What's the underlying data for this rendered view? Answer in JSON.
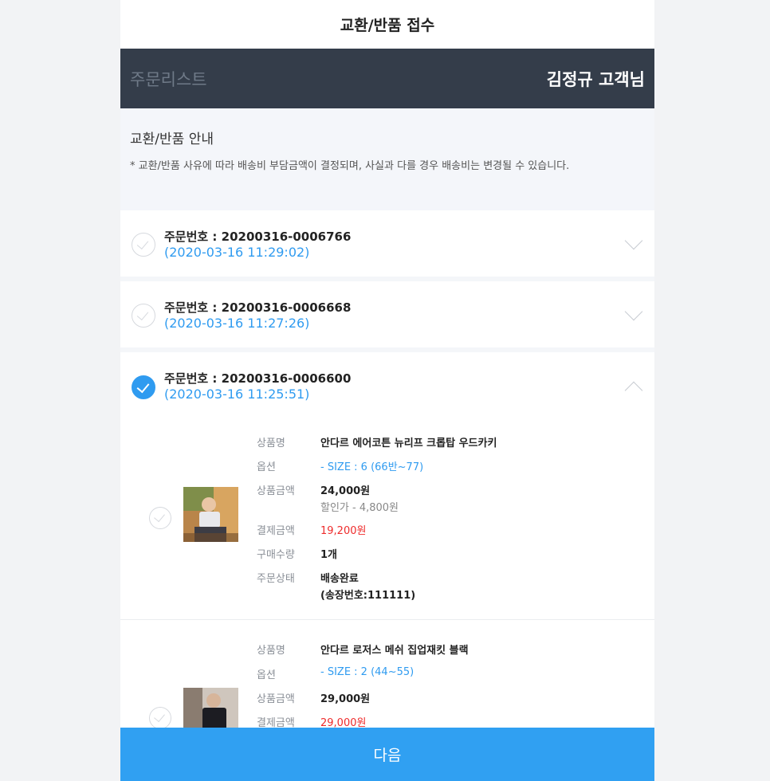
{
  "topbar": {
    "title": "교환/반품 접수"
  },
  "header": {
    "left": "주문리스트",
    "right": "김정규 고객님"
  },
  "notice": {
    "title": "교환/반품 안내",
    "text": "* 교환/반품 사유에 따라 배송비 부담금액이 결정되며, 사실과 다를 경우 배송비는 변경될 수 있습니다."
  },
  "orders": [
    {
      "number": "주문번호 : 20200316-0006766",
      "date": "(2020-03-16 11:29:02)",
      "selected": false,
      "expanded": false
    },
    {
      "number": "주문번호 : 20200316-0006668",
      "date": "(2020-03-16 11:27:26)",
      "selected": false,
      "expanded": false
    },
    {
      "number": "주문번호 : 20200316-0006600",
      "date": "(2020-03-16 11:25:51)",
      "selected": true,
      "expanded": true
    }
  ],
  "labels": {
    "product_name": "상품명",
    "option": "옵션",
    "price": "상품금액",
    "payment": "결제금액",
    "quantity": "구매수량",
    "status": "주문상태"
  },
  "products": [
    {
      "name": "안다르 에어코튼 뉴리프 크롭탑 우드카키",
      "option": "- SIZE : 6 (66반~77)",
      "price": "24,000원",
      "discount": "할인가 - 4,800원",
      "payment": "19,200원",
      "quantity": "1개",
      "status": "배송완료",
      "tracking": "(송장번호:111111)",
      "thumb_icon": "product-photo-icon"
    },
    {
      "name": "안다르 로저스 메쉬 집업재킷 블랙",
      "option": "- SIZE : 2 (44~55)",
      "price": "29,000원",
      "payment": "29,000원",
      "thumb_icon": "product-photo-icon"
    }
  ],
  "footer": {
    "next_label": "다음"
  },
  "colors": {
    "accent": "#30a0f2",
    "header_bg": "#343d4a",
    "price_red": "#ee2b2b"
  }
}
